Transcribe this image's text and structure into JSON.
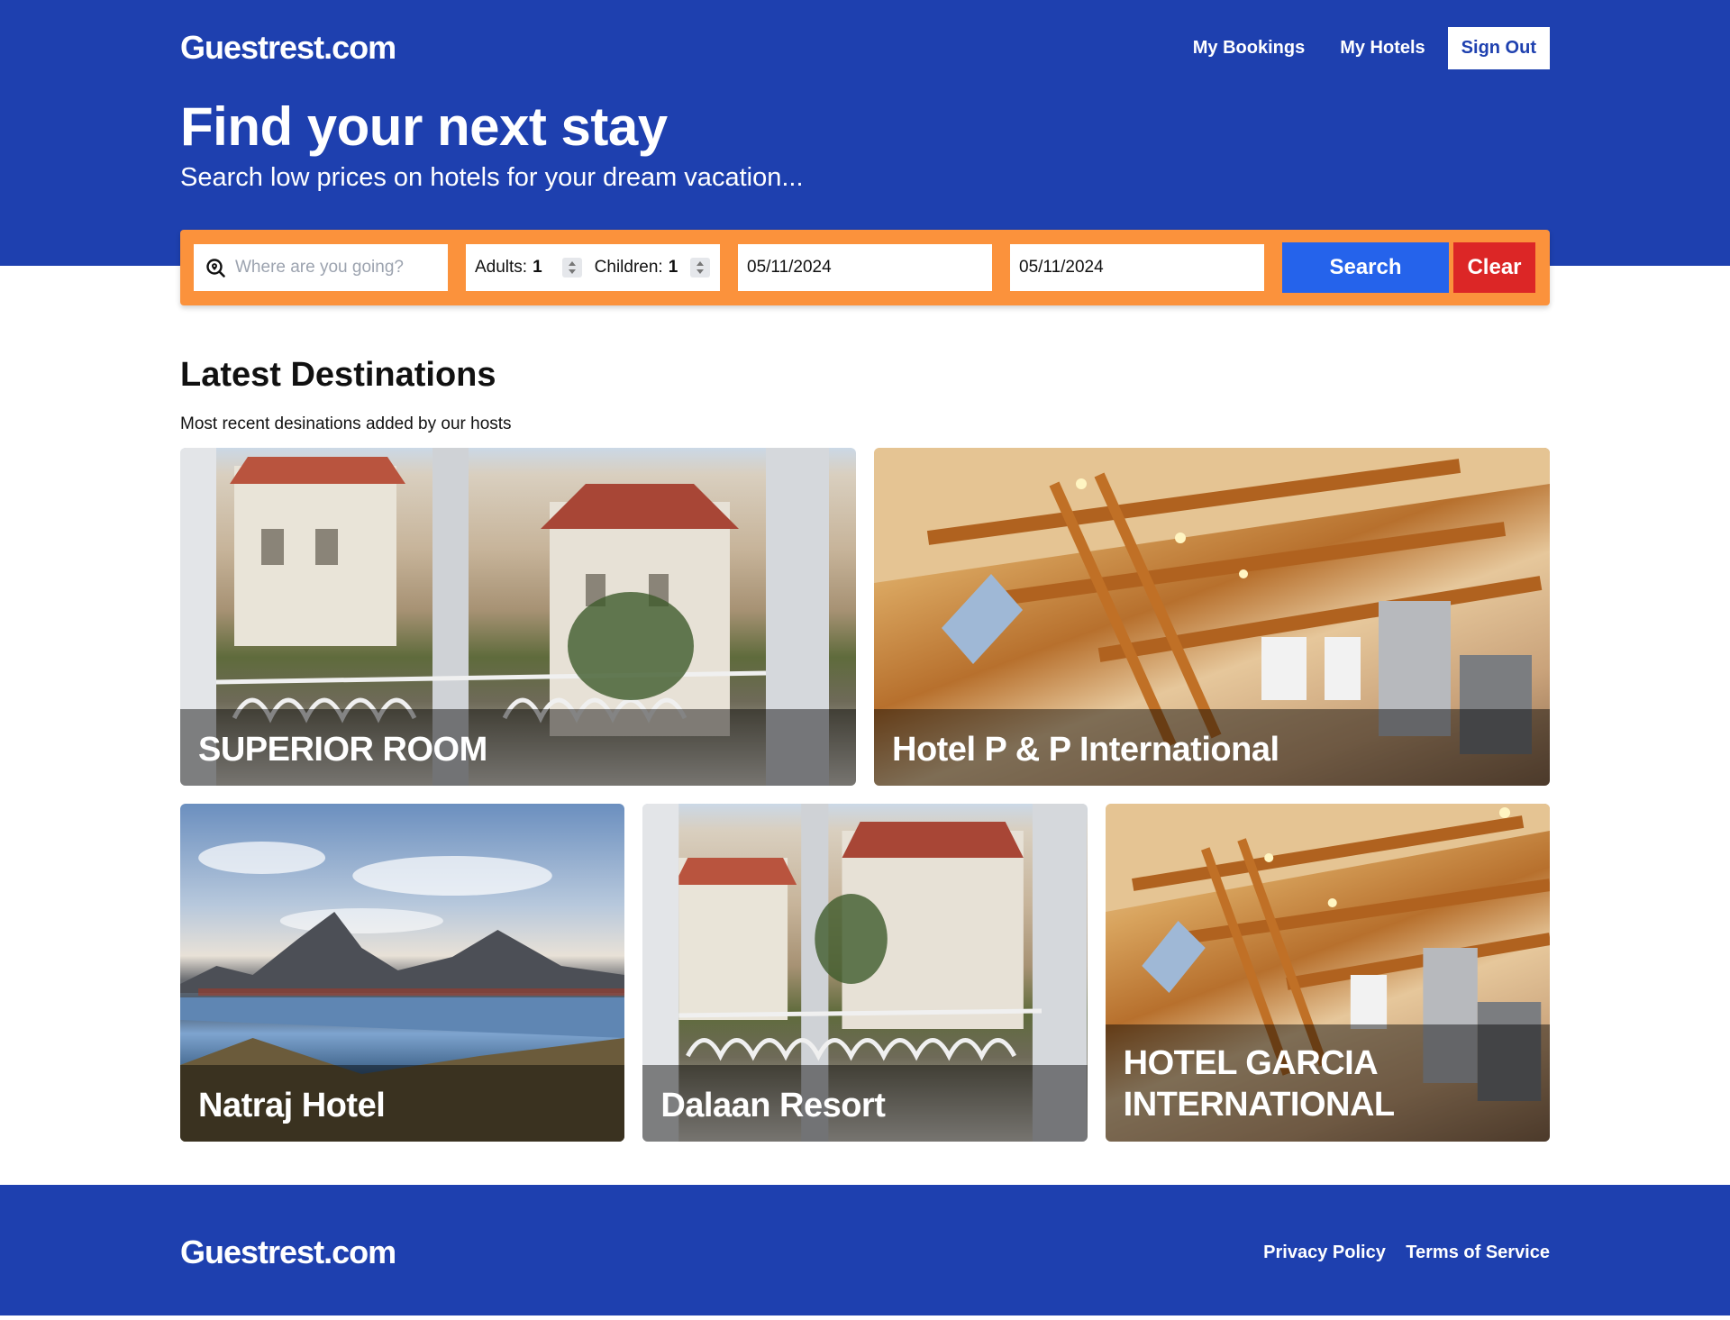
{
  "header": {
    "logo": "Guestrest.com",
    "nav": {
      "bookings": "My Bookings",
      "hotels": "My Hotels",
      "signout": "Sign Out"
    }
  },
  "hero": {
    "title": "Find your next stay",
    "subtitle": "Search low prices on hotels for your dream vacation..."
  },
  "search": {
    "destination_placeholder": "Where are you going?",
    "adults_label": "Adults:",
    "adults_value": "1",
    "children_label": "Children:",
    "children_value": "1",
    "checkin": "05/11/2024",
    "checkout": "05/11/2024",
    "search_label": "Search",
    "clear_label": "Clear",
    "icon": "search-location-icon"
  },
  "latest": {
    "title": "Latest Destinations",
    "subtitle": "Most recent desinations added by our hosts",
    "hotels": [
      {
        "name": "SUPERIOR ROOM"
      },
      {
        "name": "Hotel P & P International"
      },
      {
        "name": "Natraj Hotel"
      },
      {
        "name": "Dalaan Resort"
      },
      {
        "name": "HOTEL GARCIA INTERNATIONAL"
      }
    ]
  },
  "footer": {
    "logo": "Guestrest.com",
    "privacy": "Privacy Policy",
    "terms": "Terms of Service"
  },
  "colors": {
    "brand": "#1e40af",
    "searchbar": "#fb923c",
    "search_btn": "#2563eb",
    "clear_btn": "#dc2626"
  }
}
